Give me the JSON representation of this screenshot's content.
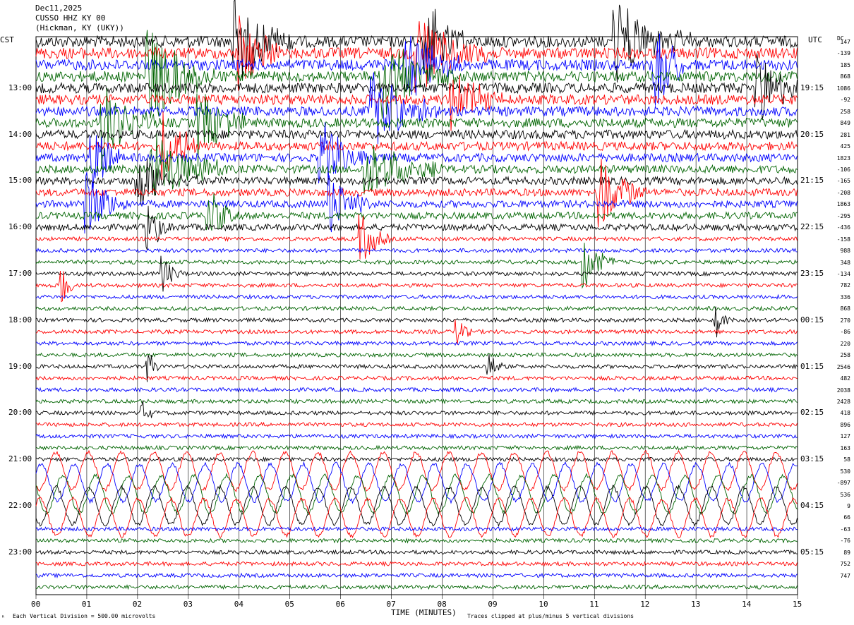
{
  "header": {
    "date": "Dec11,2025",
    "station": "CUSSO HHZ KY 00",
    "location": "(Hickman, KY (UKY))"
  },
  "axis": {
    "left_tz": "CST",
    "right_tz": "UTC",
    "dc_label": "DC",
    "xlabel": "TIME (MINUTES)",
    "scale_note": "Each Vertical Division =  500.00 microvolts",
    "clip_note": "Traces clipped at plus/minus 5 vertical divisions",
    "corner_mark": "ᴿ"
  },
  "chart_data": {
    "type": "line",
    "title": "Dec11,2025 CUSSO HHZ KY 00 (Hickman, KY (UKY))",
    "xlabel": "TIME (MINUTES)",
    "xlim": [
      0,
      15
    ],
    "x_ticks": [
      "00",
      "01",
      "02",
      "03",
      "04",
      "05",
      "06",
      "07",
      "08",
      "09",
      "10",
      "11",
      "12",
      "13",
      "14",
      "15"
    ],
    "left_ticks": [
      {
        "row": 4,
        "label": "13:00"
      },
      {
        "row": 8,
        "label": "14:00"
      },
      {
        "row": 12,
        "label": "15:00"
      },
      {
        "row": 16,
        "label": "16:00"
      },
      {
        "row": 20,
        "label": "17:00"
      },
      {
        "row": 24,
        "label": "18:00"
      },
      {
        "row": 28,
        "label": "19:00"
      },
      {
        "row": 32,
        "label": "20:00"
      },
      {
        "row": 36,
        "label": "21:00"
      },
      {
        "row": 40,
        "label": "22:00"
      },
      {
        "row": 44,
        "label": "23:00"
      }
    ],
    "right_ticks": [
      {
        "row": 4,
        "label": "19:15"
      },
      {
        "row": 8,
        "label": "20:15"
      },
      {
        "row": 12,
        "label": "21:15"
      },
      {
        "row": 16,
        "label": "22:15"
      },
      {
        "row": 20,
        "label": "23:15"
      },
      {
        "row": 24,
        "label": "00:15"
      },
      {
        "row": 28,
        "label": "01:15"
      },
      {
        "row": 32,
        "label": "02:15"
      },
      {
        "row": 36,
        "label": "03:15"
      },
      {
        "row": 40,
        "label": "04:15"
      },
      {
        "row": 44,
        "label": "05:15"
      }
    ],
    "dc_offsets": [
      "147",
      "-139",
      "185",
      "868",
      "1086",
      "-92",
      "258",
      "849",
      "281",
      "425",
      "1823",
      "-106",
      "-165",
      "-208",
      "1863",
      "-295",
      "-436",
      "-158",
      "988",
      "348",
      "-134",
      "782",
      "336",
      "868",
      "270",
      "-86",
      "220",
      "258",
      "2546",
      "482",
      "2038",
      "2428",
      "418",
      "896",
      "127",
      "163",
      "58",
      "530",
      "-897",
      "536",
      "9",
      "66",
      "-63",
      "-76",
      "89",
      "752",
      "747"
    ],
    "trace_colors": [
      "#000000",
      "#ff0000",
      "#0000ff",
      "#006400"
    ],
    "rows": 48,
    "minutes_per_row": 15,
    "amplitude_unit": "microvolts",
    "vertical_division_microvolts": 500,
    "clip_divisions": 5,
    "events": [
      {
        "row": 0,
        "minute": 3.9,
        "amp": 9,
        "dur": 1.2
      },
      {
        "row": 0,
        "minute": 7.6,
        "amp": 9,
        "dur": 1.0
      },
      {
        "row": 0,
        "minute": 11.4,
        "amp": 8,
        "dur": 1.5
      },
      {
        "row": 1,
        "minute": 4.0,
        "amp": 8,
        "dur": 1.0
      },
      {
        "row": 1,
        "minute": 7.5,
        "amp": 8,
        "dur": 1.5
      },
      {
        "row": 2,
        "minute": 7.3,
        "amp": 7,
        "dur": 1.2
      },
      {
        "row": 2,
        "minute": 12.2,
        "amp": 9,
        "dur": 0.8
      },
      {
        "row": 3,
        "minute": 2.2,
        "amp": 9,
        "dur": 1.5
      },
      {
        "row": 3,
        "minute": 6.8,
        "amp": 8,
        "dur": 1.5
      },
      {
        "row": 4,
        "minute": 14.2,
        "amp": 7,
        "dur": 1.0
      },
      {
        "row": 5,
        "minute": 8.2,
        "amp": 6,
        "dur": 1.0
      },
      {
        "row": 6,
        "minute": 6.6,
        "amp": 7,
        "dur": 1.5
      },
      {
        "row": 7,
        "minute": 1.3,
        "amp": 8,
        "dur": 1.2
      },
      {
        "row": 7,
        "minute": 3.2,
        "amp": 8,
        "dur": 1.0
      },
      {
        "row": 9,
        "minute": 2.5,
        "amp": 7,
        "dur": 0.8
      },
      {
        "row": 10,
        "minute": 1.1,
        "amp": 8,
        "dur": 0.6
      },
      {
        "row": 10,
        "minute": 5.6,
        "amp": 7,
        "dur": 1.0
      },
      {
        "row": 11,
        "minute": 2.3,
        "amp": 7,
        "dur": 1.5
      },
      {
        "row": 11,
        "minute": 6.5,
        "amp": 6,
        "dur": 1.5
      },
      {
        "row": 12,
        "minute": 2.0,
        "amp": 6,
        "dur": 1.2
      },
      {
        "row": 13,
        "minute": 11.1,
        "amp": 7,
        "dur": 1.0
      },
      {
        "row": 14,
        "minute": 1.0,
        "amp": 7,
        "dur": 0.8
      },
      {
        "row": 14,
        "minute": 5.8,
        "amp": 6,
        "dur": 0.8
      },
      {
        "row": 15,
        "minute": 3.4,
        "amp": 5,
        "dur": 0.6
      },
      {
        "row": 16,
        "minute": 2.2,
        "amp": 5,
        "dur": 0.5
      },
      {
        "row": 17,
        "minute": 6.4,
        "amp": 5,
        "dur": 0.6
      },
      {
        "row": 19,
        "minute": 10.8,
        "amp": 5,
        "dur": 0.6
      },
      {
        "row": 20,
        "minute": 2.5,
        "amp": 4,
        "dur": 0.4
      },
      {
        "row": 21,
        "minute": 0.5,
        "amp": 4,
        "dur": 0.3
      },
      {
        "row": 24,
        "minute": 13.4,
        "amp": 3,
        "dur": 0.3
      },
      {
        "row": 25,
        "minute": 8.3,
        "amp": 3,
        "dur": 0.3
      },
      {
        "row": 28,
        "minute": 8.9,
        "amp": 4,
        "dur": 0.3
      },
      {
        "row": 28,
        "minute": 2.2,
        "amp": 3,
        "dur": 0.3
      },
      {
        "row": 32,
        "minute": 2.1,
        "amp": 2,
        "dur": 0.3
      }
    ],
    "long_period_rows": [
      37,
      38,
      39,
      40,
      41
    ]
  }
}
